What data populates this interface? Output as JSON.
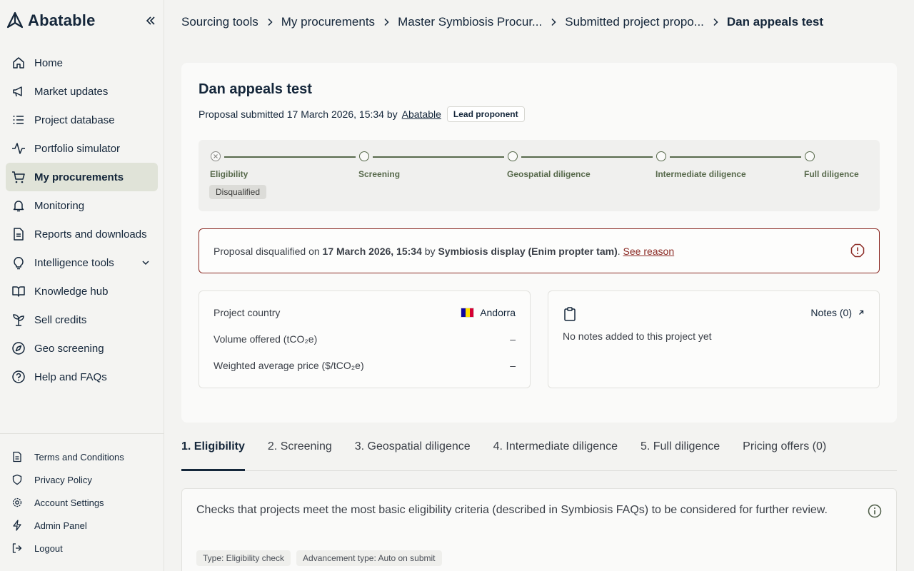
{
  "app": {
    "name": "Abatable"
  },
  "sidebar": {
    "items": [
      {
        "label": "Home",
        "icon": "home-icon"
      },
      {
        "label": "Market updates",
        "icon": "megaphone-icon"
      },
      {
        "label": "Project database",
        "icon": "list-icon"
      },
      {
        "label": "Portfolio simulator",
        "icon": "activity-icon"
      },
      {
        "label": "My procurements",
        "icon": "cart-icon",
        "active": true
      },
      {
        "label": "Monitoring",
        "icon": "bell-icon"
      },
      {
        "label": "Reports and downloads",
        "icon": "file-icon"
      },
      {
        "label": "Intelligence tools",
        "icon": "lightbulb-icon",
        "expandable": true
      },
      {
        "label": "Knowledge hub",
        "icon": "book-icon"
      },
      {
        "label": "Sell credits",
        "icon": "sprout-icon"
      },
      {
        "label": "Geo screening",
        "icon": "compass-icon"
      },
      {
        "label": "Help and FAQs",
        "icon": "help-icon"
      }
    ],
    "footer": [
      {
        "label": "Terms and Conditions",
        "icon": "document-icon"
      },
      {
        "label": "Privacy Policy",
        "icon": "shield-icon"
      },
      {
        "label": "Account Settings",
        "icon": "gear-icon"
      },
      {
        "label": "Admin Panel",
        "icon": "bolt-icon"
      },
      {
        "label": "Logout",
        "icon": "logout-icon"
      }
    ]
  },
  "breadcrumb": [
    "Sourcing tools",
    "My procurements",
    "Master Symbiosis Procur...",
    "Submitted project propo...",
    "Dan appeals test"
  ],
  "proposal": {
    "title": "Dan appeals test",
    "submitted_prefix": "Proposal submitted 17 March 2026, 15:34 by",
    "submitted_by": "Abatable",
    "role_badge": "Lead proponent"
  },
  "stepper": {
    "steps": [
      "Eligibility",
      "Screening",
      "Geospatial diligence",
      "Intermediate diligence",
      "Full diligence"
    ],
    "status_badge": "Disqualified"
  },
  "alert": {
    "prefix": "Proposal disqualified on ",
    "date": "17 March 2026, 15:34",
    "mid": " by ",
    "actor": "Symbiosis display (Enim propter tam)",
    "dot": ". ",
    "link": "See reason"
  },
  "details": {
    "country_label": "Project country",
    "country_value": "Andorra",
    "volume_label": "Volume offered (tCO₂e)",
    "volume_value": "–",
    "price_label": "Weighted average price ($/tCO₂e)",
    "price_value": "–"
  },
  "notes": {
    "link": "Notes (0)",
    "empty": "No notes added to this project yet"
  },
  "tabs": [
    "1. Eligibility",
    "2. Screening",
    "3. Geospatial diligence",
    "4. Intermediate diligence",
    "5. Full diligence",
    "Pricing offers (0)"
  ],
  "section": {
    "description": "Checks that projects meet the most basic eligibility criteria (described in Symbiosis FAQs) to be considered for further review.",
    "tags": [
      "Type: Eligibility check",
      "Advancement type: Auto on submit"
    ]
  },
  "colors": {
    "primary": "#14263a",
    "accent_green": "#586a4c",
    "alert_red": "#8b2a24",
    "active_nav_bg": "#e0e3d8"
  }
}
